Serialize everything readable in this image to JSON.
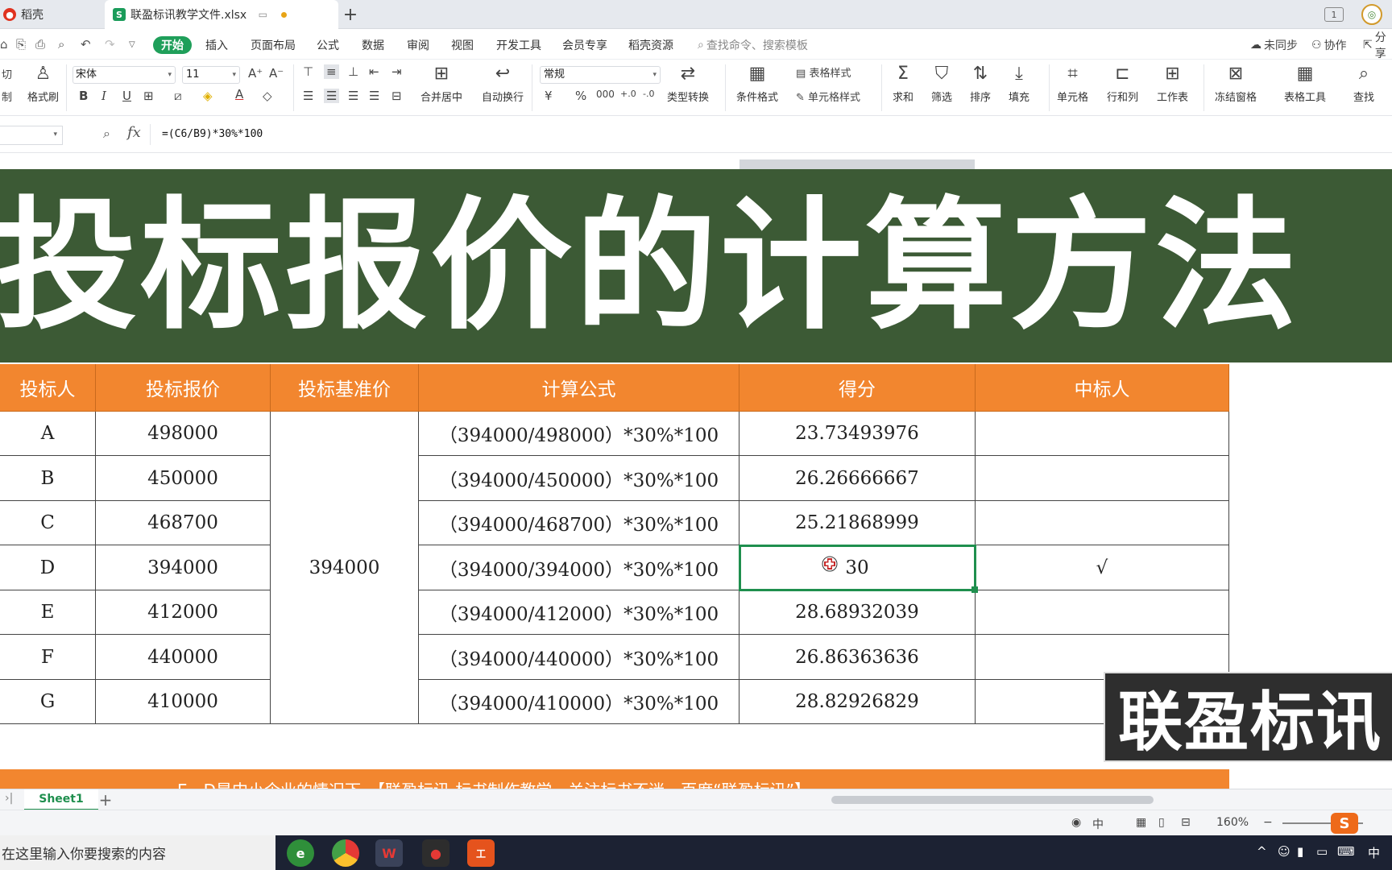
{
  "tabs": {
    "inactive_label": "稻壳",
    "active_label": "联盈标讯教学文件.xlsx",
    "new_tab": "+",
    "window_badge": "1"
  },
  "menu": {
    "items": [
      "开始",
      "插入",
      "页面布局",
      "公式",
      "数据",
      "审阅",
      "视图",
      "开发工具",
      "会员专享",
      "稻壳资源"
    ],
    "search_placeholder": "查找命令、搜索模板",
    "sync": "未同步",
    "collab": "协作",
    "share": "分享"
  },
  "ribbon": {
    "cut": "切",
    "copy": "制",
    "format_painter": "格式刷",
    "font_name": "宋体",
    "font_size": "11",
    "merge_center": "合并居中",
    "wrap_text": "自动换行",
    "number_format": "常规",
    "type_convert": "类型转换",
    "cond_format": "条件格式",
    "table_style": "表格样式",
    "cell_style": "单元格样式",
    "sum": "求和",
    "filter": "筛选",
    "sort": "排序",
    "fill": "填充",
    "cell": "单元格",
    "row_col": "行和列",
    "worksheet": "工作表",
    "freeze": "冻结窗格",
    "table_tools": "表格工具",
    "find": "查找"
  },
  "formula_bar": {
    "fx": "fx",
    "formula": "=(C6/B9)*30%*100"
  },
  "banner": {
    "title": "投标报价的计算方法"
  },
  "table": {
    "headers": [
      "投标人",
      "投标报价",
      "投标基准价",
      "计算公式",
      "得分",
      "中标人"
    ],
    "base_price": "394000",
    "rows": [
      {
        "bidder": "A",
        "price": "498000",
        "formula": "（394000/498000）*30%*100",
        "score": "23.73493976",
        "winner": ""
      },
      {
        "bidder": "B",
        "price": "450000",
        "formula": "（394000/450000）*30%*100",
        "score": "26.26666667",
        "winner": ""
      },
      {
        "bidder": "C",
        "price": "468700",
        "formula": "（394000/468700）*30%*100",
        "score": "25.21868999",
        "winner": ""
      },
      {
        "bidder": "D",
        "price": "394000",
        "formula": "（394000/394000）*30%*100",
        "score": "30",
        "winner": "√"
      },
      {
        "bidder": "E",
        "price": "412000",
        "formula": "（394000/412000）*30%*100",
        "score": "28.68932039",
        "winner": ""
      },
      {
        "bidder": "F",
        "price": "440000",
        "formula": "（394000/440000）*30%*100",
        "score": "26.86363636",
        "winner": ""
      },
      {
        "bidder": "G",
        "price": "410000",
        "formula": "（394000/410000）*30%*100",
        "score": "28.82926829",
        "winner": ""
      }
    ],
    "footer_text": "E、D是中小企业的情况下，【联盈标讯-标书制作教学，关注标书不迷，百度“联盈标讯”】"
  },
  "watermark": "联盈标讯",
  "sheetbar": {
    "sheet_name": "Sheet1",
    "add": "+"
  },
  "statusbar": {
    "ime": "中",
    "zoom": "160%",
    "ime_badge": "S"
  },
  "taskbar": {
    "search_placeholder": "在这里输入你要搜索的内容",
    "tray_ime": "中"
  }
}
